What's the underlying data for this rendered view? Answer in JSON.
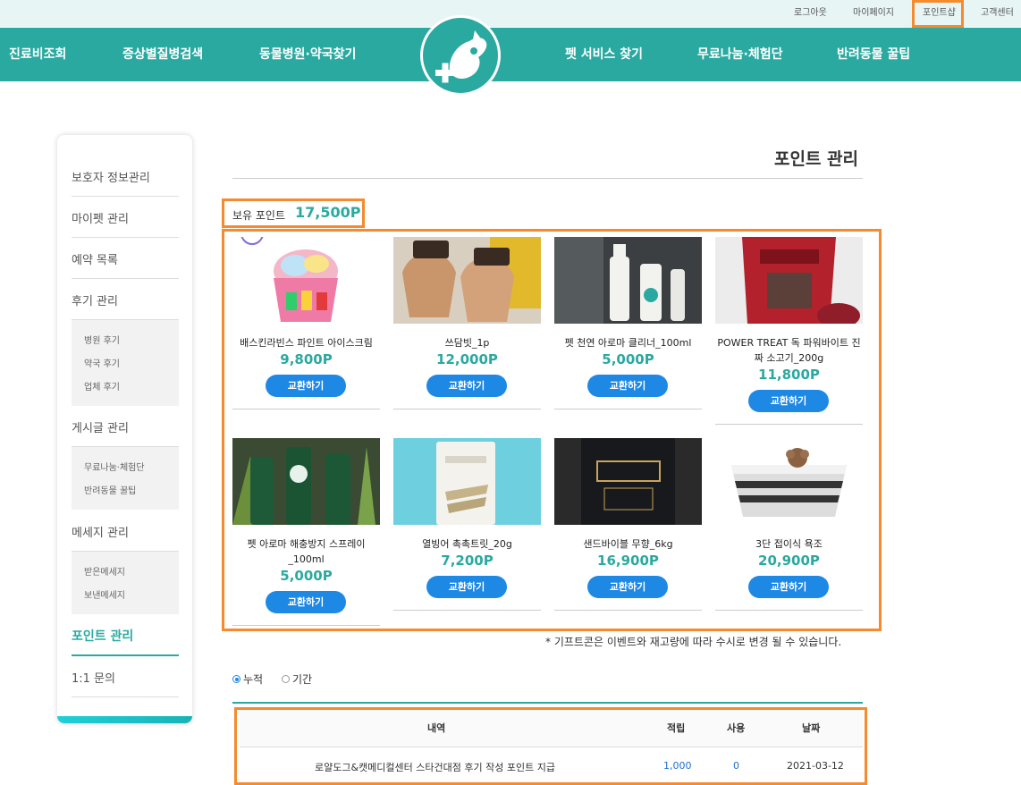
{
  "topbar": {
    "links": [
      "로그아웃",
      "마이페이지",
      "포인트샵",
      "고객센터"
    ]
  },
  "nav": {
    "items": [
      "진료비조회",
      "증상별질병검색",
      "동물병원·약국찾기",
      "펫 서비스 찾기",
      "무료나눔·체험단",
      "반려동물 꿀팁"
    ]
  },
  "sidebar": {
    "guardian": "보호자 정보관리",
    "mypet": "마이펫 관리",
    "reservation": "예약 목록",
    "review": "후기 관리",
    "review_subs": [
      "병원 후기",
      "약국 후기",
      "업체 후기"
    ],
    "posts": "게시글 관리",
    "posts_subs": [
      "무료나눔·체험단",
      "반려동물 꿀팁"
    ],
    "message": "메세지 관리",
    "message_subs": [
      "받은메세지",
      "보낸메세지"
    ],
    "points": "포인트 관리",
    "inquiry": "1:1 문의"
  },
  "page": {
    "title": "포인트 관리",
    "points_label": "보유 포인트",
    "points_value": "17,500P",
    "notice": "* 기프트콘은 이벤트와 재고량에 따라 수시로 변경 될 수 있습니다."
  },
  "products": [
    {
      "name": "배스킨라빈스 파인트 아이스크림",
      "price": "9,800P",
      "button": "교환하기"
    },
    {
      "name": "쓰담빗_1p",
      "price": "12,000P",
      "button": "교환하기"
    },
    {
      "name": "펫 천연 아로마 클리너_100ml",
      "price": "5,000P",
      "button": "교환하기"
    },
    {
      "name": "POWER TREAT 독 파워바이트 진짜 소고기_200g",
      "price": "11,800P",
      "button": "교환하기"
    },
    {
      "name": "펫 아로마 해충방지 스프레이_100ml",
      "price": "5,000P",
      "button": "교환하기"
    },
    {
      "name": "열빙어 촉촉트릿_20g",
      "price": "7,200P",
      "button": "교환하기"
    },
    {
      "name": "샌드바이블 무향_6kg",
      "price": "16,900P",
      "button": "교환하기"
    },
    {
      "name": "3단 접이식 욕조",
      "price": "20,900P",
      "button": "교환하기"
    }
  ],
  "filter": {
    "cumulative": "누적",
    "period": "기간"
  },
  "history": {
    "headers": [
      "내역",
      "적립",
      "사용",
      "날짜"
    ],
    "rows": [
      {
        "desc": "로얄도그&캣메디컬센터 스타건대점 후기 작성 포인트 지급",
        "earned": "1,000",
        "used": "0",
        "date": "2021-03-12"
      }
    ]
  },
  "colors": {
    "teal": "#2aa9a0",
    "button_blue": "#1e88e5",
    "highlight_orange": "#f58a2f"
  }
}
